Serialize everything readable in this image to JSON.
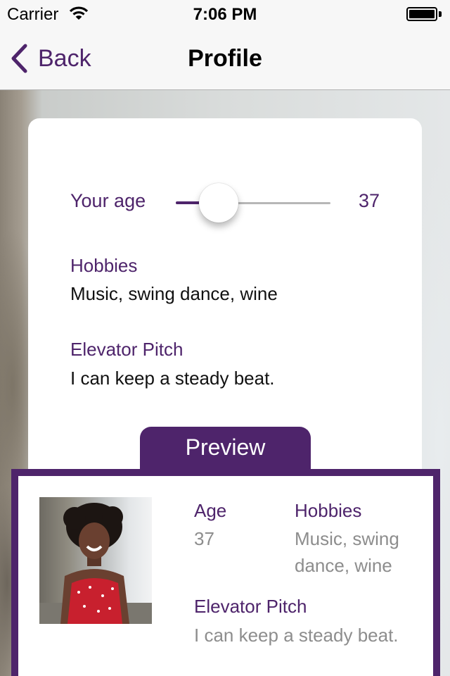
{
  "status_bar": {
    "carrier": "Carrier",
    "time": "7:06 PM"
  },
  "nav": {
    "back_label": "Back",
    "title": "Profile"
  },
  "form": {
    "age_label": "Your age",
    "age_value": "37",
    "age_slider_fraction": 0.25,
    "hobbies_label": "Hobbies",
    "hobbies_value": "Music, swing dance, wine",
    "pitch_label": "Elevator Pitch",
    "pitch_value": "I can keep a steady beat."
  },
  "preview": {
    "tab_label": "Preview",
    "age_label": "Age",
    "age_value": "37",
    "hobbies_label": "Hobbies",
    "hobbies_line1": "Music, swing",
    "hobbies_line2": "dance, wine",
    "pitch_label": "Elevator Pitch",
    "pitch_value": "I can keep a steady beat."
  },
  "colors": {
    "accent": "#4e246b",
    "muted_text": "#8d8d8d"
  }
}
